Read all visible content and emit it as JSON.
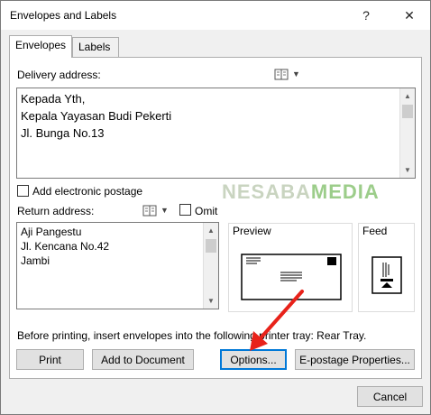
{
  "window": {
    "title": "Envelopes and Labels",
    "help_glyph": "?",
    "close_glyph": "✕"
  },
  "tabs": [
    {
      "label": "Envelopes",
      "active": true
    },
    {
      "label": "Labels",
      "active": false
    }
  ],
  "delivery": {
    "label": "Delivery address:",
    "lines": [
      "Kepada Yth,",
      "Kepala Yayasan Budi Pekerti",
      "Jl. Bunga No.13"
    ],
    "icon": "address-book-icon"
  },
  "postage": {
    "label": "Add electronic postage",
    "checked": false
  },
  "watermark": {
    "part1": "NESABA",
    "part2": "MEDIA"
  },
  "return": {
    "label": "Return address:",
    "lines": [
      "Aji Pangestu",
      "Jl. Kencana No.42",
      "Jambi"
    ],
    "omit_label": "Omit",
    "omit_checked": false,
    "icon": "address-book-icon"
  },
  "preview": {
    "label": "Preview"
  },
  "feed": {
    "label": "Feed"
  },
  "status": "Before printing, insert envelopes into the following printer tray: Rear Tray.",
  "buttons": {
    "print": "Print",
    "add_to_document": "Add to Document",
    "options": "Options...",
    "epostage": "E-postage Properties...",
    "cancel": "Cancel"
  },
  "colors": {
    "arrow": "#e8221a",
    "focus": "#0078d7"
  }
}
